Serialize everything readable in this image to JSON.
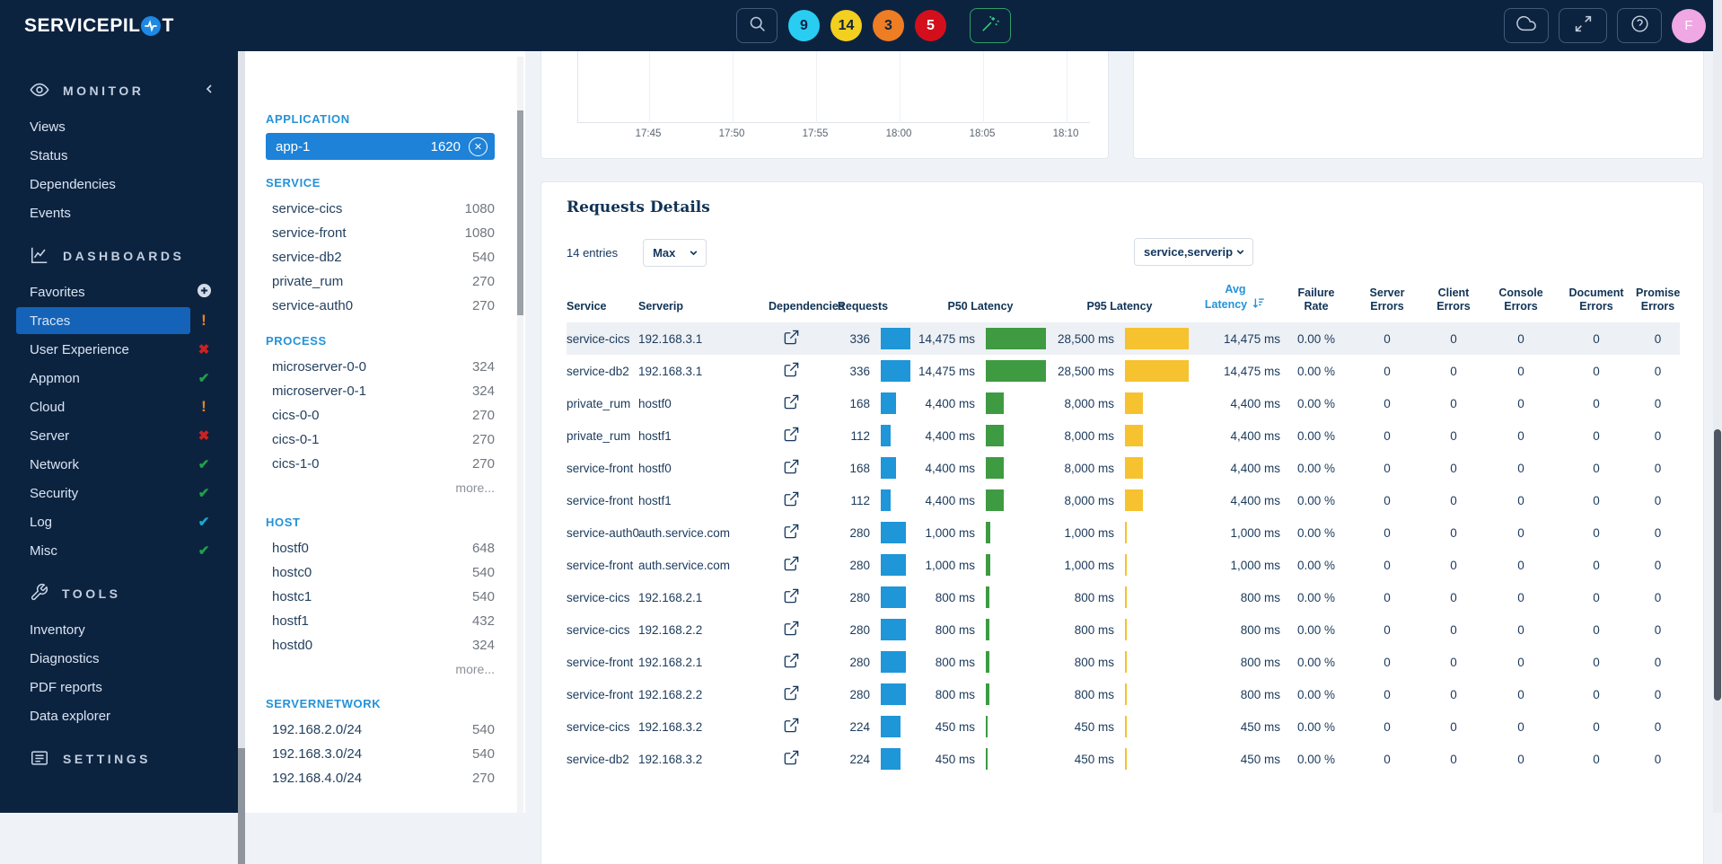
{
  "topbar": {
    "logo_part1": "SERVICEPIL",
    "logo_part2": "T",
    "badges": [
      {
        "value": "9",
        "color": "#29cdf2",
        "text_color": "#0c2340"
      },
      {
        "value": "14",
        "color": "#f3cf1f",
        "text_color": "#0c2340"
      },
      {
        "value": "3",
        "color": "#ee7d23",
        "text_color": "#0c2340"
      },
      {
        "value": "5",
        "color": "#d40f1c",
        "text_color": "#ffffff"
      }
    ],
    "avatar_initial": "F"
  },
  "sidebar": {
    "sections": [
      {
        "label": "MONITOR",
        "icon": "eye-icon",
        "collapsible": true,
        "items": [
          {
            "label": "Views"
          },
          {
            "label": "Status"
          },
          {
            "label": "Dependencies"
          },
          {
            "label": "Events"
          }
        ]
      },
      {
        "label": "DASHBOARDS",
        "icon": "dashboard-icon",
        "items": [
          {
            "label": "Favorites",
            "status": "add"
          },
          {
            "label": "Traces",
            "status": "warn",
            "selected": true
          },
          {
            "label": "User Experience",
            "status": "error"
          },
          {
            "label": "Appmon",
            "status": "ok"
          },
          {
            "label": "Cloud",
            "status": "warn"
          },
          {
            "label": "Server",
            "status": "error"
          },
          {
            "label": "Network",
            "status": "ok"
          },
          {
            "label": "Security",
            "status": "ok"
          },
          {
            "label": "Log",
            "status": "ok-cyan"
          },
          {
            "label": "Misc",
            "status": "ok"
          }
        ]
      },
      {
        "label": "TOOLS",
        "icon": "wrench-icon",
        "items": [
          {
            "label": "Inventory"
          },
          {
            "label": "Diagnostics"
          },
          {
            "label": "PDF reports"
          },
          {
            "label": "Data explorer"
          }
        ]
      },
      {
        "label": "SETTINGS",
        "icon": "settings-icon",
        "items": []
      }
    ]
  },
  "filters": {
    "more_label": "more...",
    "application": {
      "label": "APPLICATION",
      "chip_name": "app-1",
      "chip_count": "1620"
    },
    "sections": [
      {
        "label": "SERVICE",
        "more": false,
        "items": [
          {
            "name": "service-cics",
            "count": "1080"
          },
          {
            "name": "service-front",
            "count": "1080"
          },
          {
            "name": "service-db2",
            "count": "540"
          },
          {
            "name": "private_rum",
            "count": "270"
          },
          {
            "name": "service-auth0",
            "count": "270"
          }
        ]
      },
      {
        "label": "PROCESS",
        "more": true,
        "items": [
          {
            "name": "microserver-0-0",
            "count": "324"
          },
          {
            "name": "microserver-0-1",
            "count": "324"
          },
          {
            "name": "cics-0-0",
            "count": "270"
          },
          {
            "name": "cics-0-1",
            "count": "270"
          },
          {
            "name": "cics-1-0",
            "count": "270"
          }
        ]
      },
      {
        "label": "HOST",
        "more": true,
        "items": [
          {
            "name": "hostf0",
            "count": "648"
          },
          {
            "name": "hostc0",
            "count": "540"
          },
          {
            "name": "hostc1",
            "count": "540"
          },
          {
            "name": "hostf1",
            "count": "432"
          },
          {
            "name": "hostd0",
            "count": "324"
          }
        ]
      },
      {
        "label": "SERVERNETWORK",
        "more": false,
        "items": [
          {
            "name": "192.168.2.0/24",
            "count": "540"
          },
          {
            "name": "192.168.3.0/24",
            "count": "540"
          },
          {
            "name": "192.168.4.0/24",
            "count": "270"
          }
        ]
      }
    ]
  },
  "chart": {
    "x_ticks": [
      "17:45",
      "17:50",
      "17:55",
      "18:00",
      "18:05",
      "18:10"
    ]
  },
  "requests": {
    "title": "Requests Details",
    "entries_label": "14 entries",
    "max_select_value": "Max",
    "group_select_value": "service,serverip",
    "columns": [
      "Service",
      "Serverip",
      "Dependencies",
      "Requests",
      "P50 Latency",
      "P95 Latency",
      "Avg Latency",
      "Failure Rate",
      "Server Errors",
      "Client Errors",
      "Console Errors",
      "Document Errors",
      "Promise Errors"
    ],
    "sorted_column": "Avg Latency",
    "unit": "ms",
    "max_values": {
      "requests": 336,
      "p50": 14475,
      "p95": 28500
    },
    "rows": [
      {
        "service": "service-cics",
        "serverip": "192.168.3.1",
        "requests": 336,
        "p50": 14475,
        "p95": 28500,
        "avg": 14475,
        "failure": "0.00 %",
        "errors": [
          "0",
          "0",
          "0",
          "0",
          "0"
        ],
        "highlight": true
      },
      {
        "service": "service-db2",
        "serverip": "192.168.3.1",
        "requests": 336,
        "p50": 14475,
        "p95": 28500,
        "avg": 14475,
        "failure": "0.00 %",
        "errors": [
          "0",
          "0",
          "0",
          "0",
          "0"
        ]
      },
      {
        "service": "private_rum",
        "serverip": "hostf0",
        "requests": 168,
        "p50": 4400,
        "p95": 8000,
        "avg": 4400,
        "failure": "0.00 %",
        "errors": [
          "0",
          "0",
          "0",
          "0",
          "0"
        ]
      },
      {
        "service": "private_rum",
        "serverip": "hostf1",
        "requests": 112,
        "p50": 4400,
        "p95": 8000,
        "avg": 4400,
        "failure": "0.00 %",
        "errors": [
          "0",
          "0",
          "0",
          "0",
          "0"
        ]
      },
      {
        "service": "service-front",
        "serverip": "hostf0",
        "requests": 168,
        "p50": 4400,
        "p95": 8000,
        "avg": 4400,
        "failure": "0.00 %",
        "errors": [
          "0",
          "0",
          "0",
          "0",
          "0"
        ]
      },
      {
        "service": "service-front",
        "serverip": "hostf1",
        "requests": 112,
        "p50": 4400,
        "p95": 8000,
        "avg": 4400,
        "failure": "0.00 %",
        "errors": [
          "0",
          "0",
          "0",
          "0",
          "0"
        ]
      },
      {
        "service": "service-auth0",
        "serverip": "auth.service.com",
        "requests": 280,
        "p50": 1000,
        "p95": 1000,
        "avg": 1000,
        "failure": "0.00 %",
        "errors": [
          "0",
          "0",
          "0",
          "0",
          "0"
        ]
      },
      {
        "service": "service-front",
        "serverip": "auth.service.com",
        "requests": 280,
        "p50": 1000,
        "p95": 1000,
        "avg": 1000,
        "failure": "0.00 %",
        "errors": [
          "0",
          "0",
          "0",
          "0",
          "0"
        ]
      },
      {
        "service": "service-cics",
        "serverip": "192.168.2.1",
        "requests": 280,
        "p50": 800,
        "p95": 800,
        "avg": 800,
        "failure": "0.00 %",
        "errors": [
          "0",
          "0",
          "0",
          "0",
          "0"
        ]
      },
      {
        "service": "service-cics",
        "serverip": "192.168.2.2",
        "requests": 280,
        "p50": 800,
        "p95": 800,
        "avg": 800,
        "failure": "0.00 %",
        "errors": [
          "0",
          "0",
          "0",
          "0",
          "0"
        ]
      },
      {
        "service": "service-front",
        "serverip": "192.168.2.1",
        "requests": 280,
        "p50": 800,
        "p95": 800,
        "avg": 800,
        "failure": "0.00 %",
        "errors": [
          "0",
          "0",
          "0",
          "0",
          "0"
        ]
      },
      {
        "service": "service-front",
        "serverip": "192.168.2.2",
        "requests": 280,
        "p50": 800,
        "p95": 800,
        "avg": 800,
        "failure": "0.00 %",
        "errors": [
          "0",
          "0",
          "0",
          "0",
          "0"
        ]
      },
      {
        "service": "service-cics",
        "serverip": "192.168.3.2",
        "requests": 224,
        "p50": 450,
        "p95": 450,
        "avg": 450,
        "failure": "0.00 %",
        "errors": [
          "0",
          "0",
          "0",
          "0",
          "0"
        ]
      },
      {
        "service": "service-db2",
        "serverip": "192.168.3.2",
        "requests": 224,
        "p50": 450,
        "p95": 450,
        "avg": 450,
        "failure": "0.00 %",
        "errors": [
          "0",
          "0",
          "0",
          "0",
          "0"
        ]
      }
    ]
  },
  "colors": {
    "topbar_bg": "#0c2340",
    "sidebar_selected": "#1463b8",
    "accent_blue": "#2492d8",
    "bar_requests": "#1e96d8",
    "bar_p50": "#3e9b41",
    "bar_p95": "#f6c230",
    "status_warn": "#e58523",
    "status_error": "#ce2121",
    "status_ok": "#1ea24b",
    "status_log": "#1aa9cf",
    "avatar_bg": "#efa8e4",
    "wand_green": "#35d07f"
  }
}
